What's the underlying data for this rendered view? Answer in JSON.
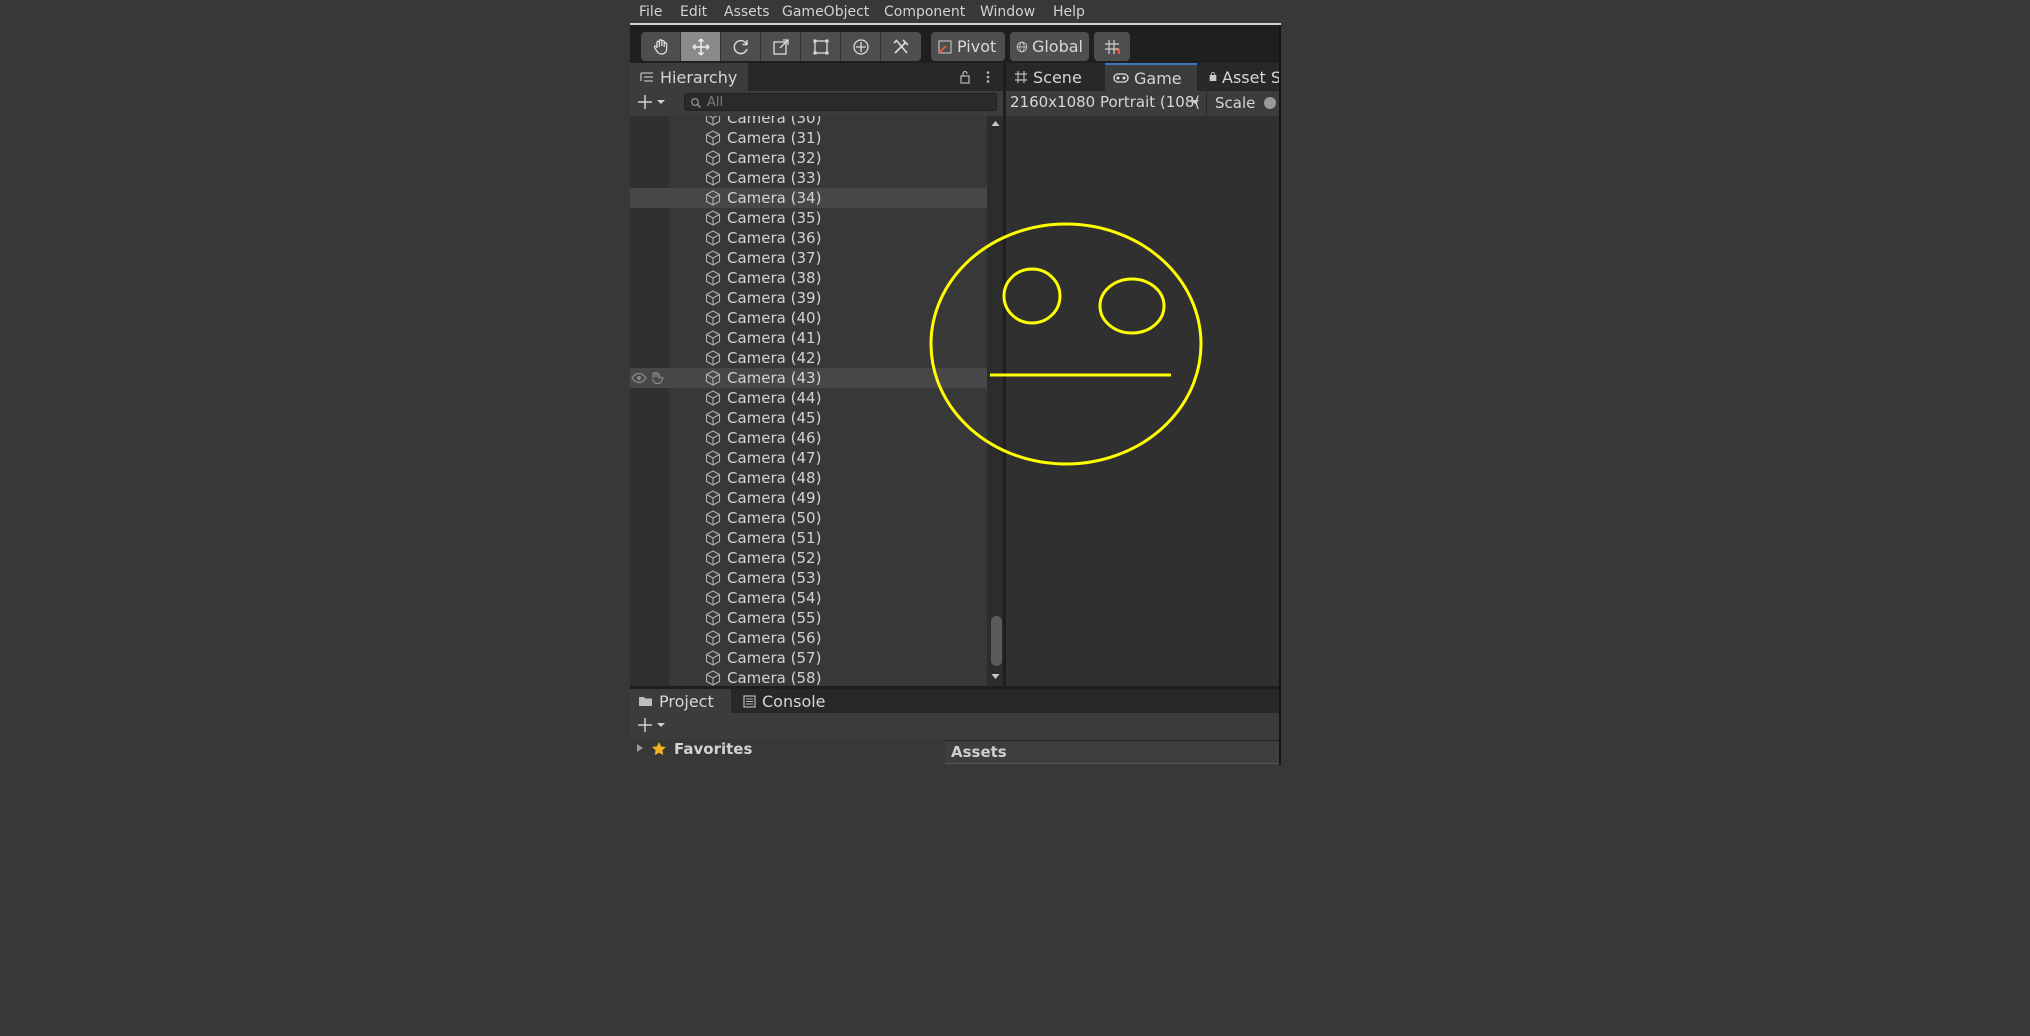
{
  "menu": [
    "File",
    "Edit",
    "Assets",
    "GameObject",
    "Component",
    "Window",
    "Help"
  ],
  "toolbar": {
    "tools": [
      "hand-tool",
      "move-tool",
      "rotate-tool",
      "scale-tool",
      "rect-tool",
      "transform-tool",
      "custom-tool"
    ],
    "active_tool": "move-tool",
    "pivot_label": "Pivot",
    "global_label": "Global"
  },
  "hierarchy": {
    "title": "Hierarchy",
    "search_placeholder": "All",
    "items": [
      "Camera (30)",
      "Camera (31)",
      "Camera (32)",
      "Camera (33)",
      "Camera (34)",
      "Camera (35)",
      "Camera (36)",
      "Camera (37)",
      "Camera (38)",
      "Camera (39)",
      "Camera (40)",
      "Camera (41)",
      "Camera (42)",
      "Camera (43)",
      "Camera (44)",
      "Camera (45)",
      "Camera (46)",
      "Camera (47)",
      "Camera (48)",
      "Camera (49)",
      "Camera (50)",
      "Camera (51)",
      "Camera (52)",
      "Camera (53)",
      "Camera (54)",
      "Camera (55)",
      "Camera (56)",
      "Camera (57)",
      "Camera (58)"
    ],
    "highlighted": [
      "Camera (34)",
      "Camera (43)"
    ]
  },
  "scene_tabs": {
    "scene": "Scene",
    "game": "Game",
    "asset_store": "Asset S"
  },
  "game_toolbar": {
    "resolution": "2160x1080 Portrait (108(",
    "scale_label": "Scale"
  },
  "drawing": {
    "stroke_color": "#ffff00",
    "background": "#303030"
  },
  "project": {
    "tab_project": "Project",
    "tab_console": "Console",
    "favorites": "Favorites",
    "assets": "Assets"
  }
}
